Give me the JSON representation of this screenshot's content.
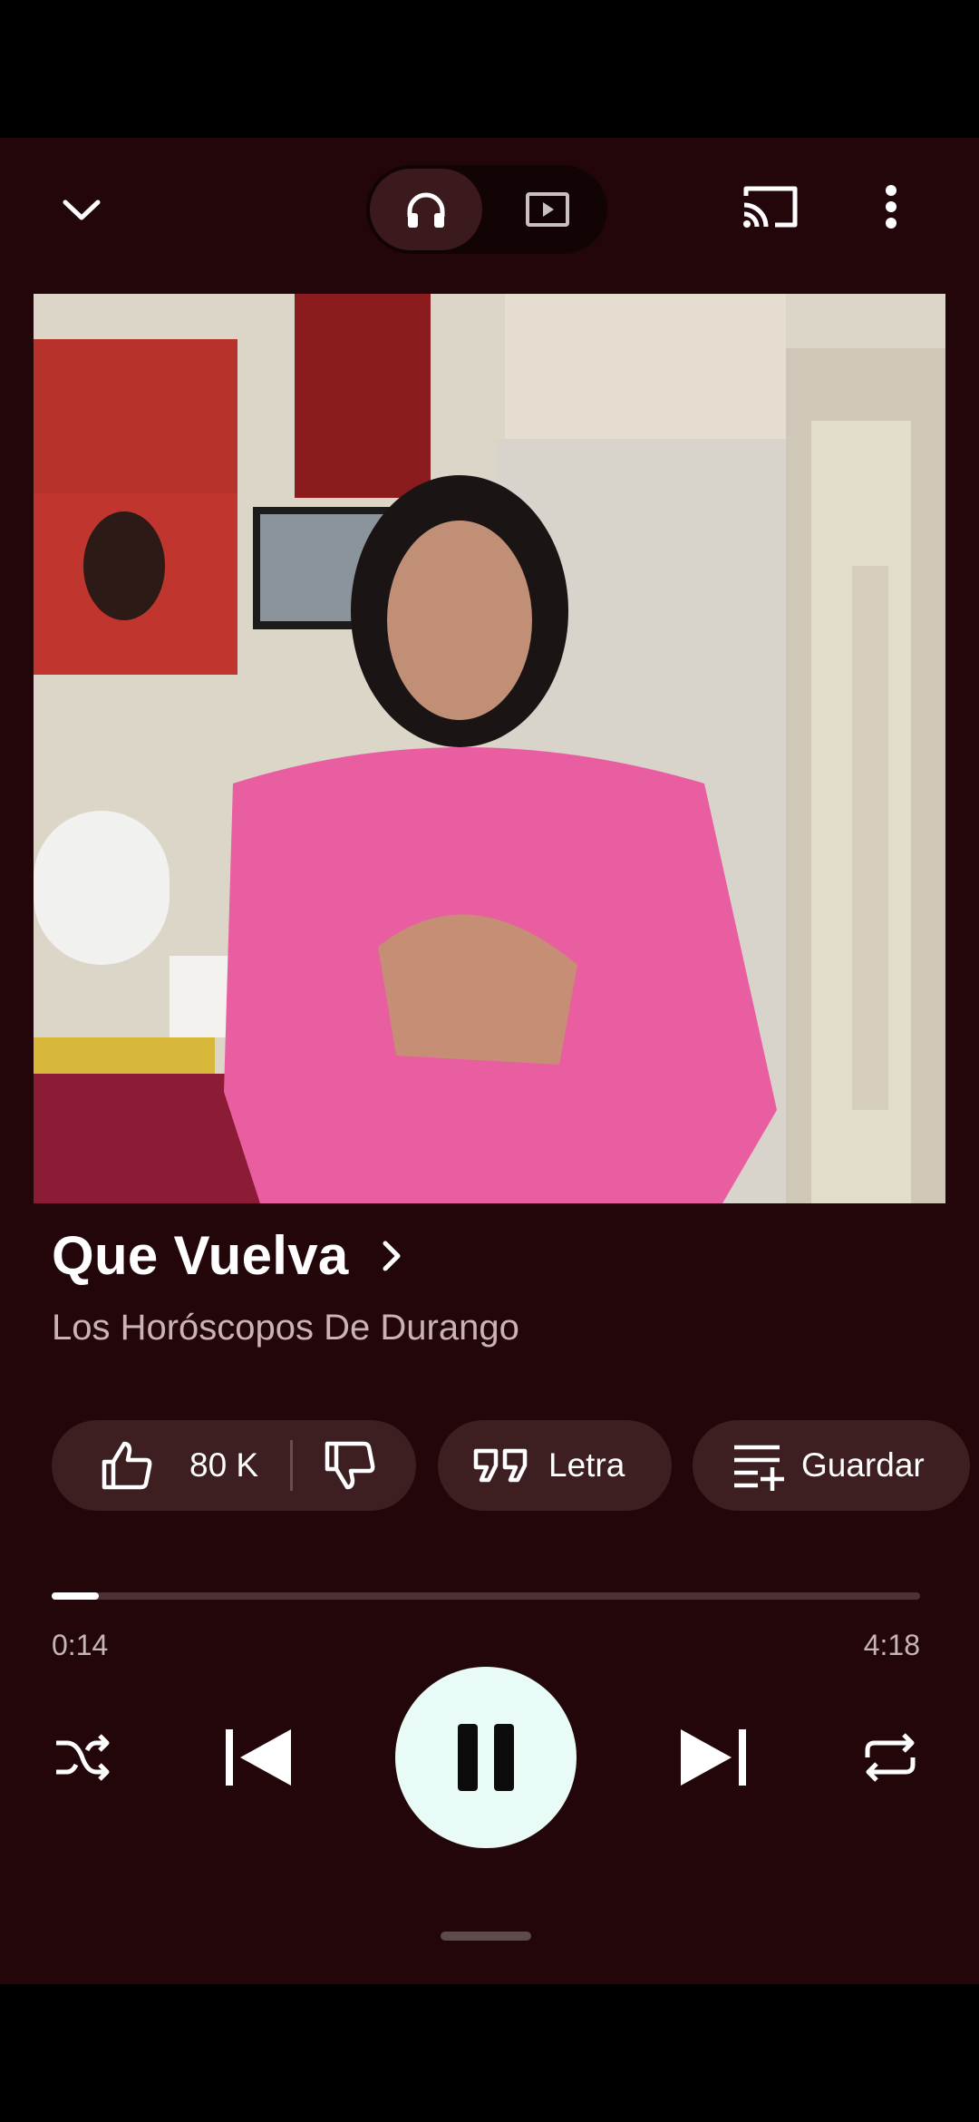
{
  "colors": {
    "background": "#230609",
    "chip": "#3d1f22",
    "play_button": "#e8fbf7",
    "secondary_text": "#c9b3b5"
  },
  "top_bar": {
    "collapse_icon": "chevron-down-icon",
    "audio_mode_icon": "headphones-icon",
    "video_mode_icon": "video-icon",
    "cast_icon": "cast-icon",
    "more_icon": "more-vertical-icon",
    "selected_mode": "audio"
  },
  "song": {
    "title": "Que Vuelva",
    "artist": "Los Horóscopos De Durango"
  },
  "actions": {
    "likes": "80 K",
    "lyrics_label": "Letra",
    "save_label": "Guardar"
  },
  "playback": {
    "elapsed": "0:14",
    "duration": "4:18",
    "progress_fraction": 0.054,
    "state": "playing"
  }
}
